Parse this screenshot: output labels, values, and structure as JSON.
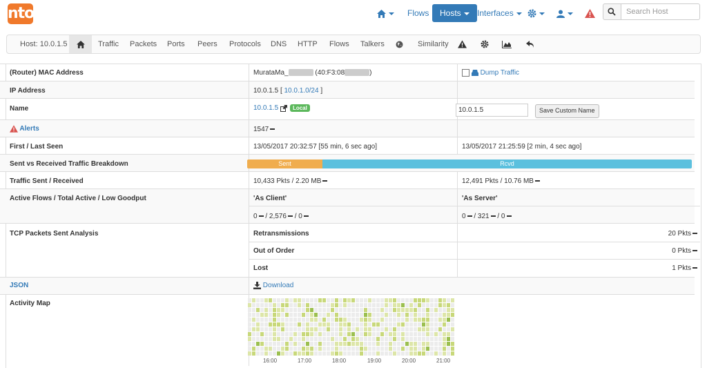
{
  "app": {
    "logo": "ntop"
  },
  "nav": {
    "flows": "Flows",
    "hosts": "Hosts",
    "interfaces": "Interfaces",
    "search_placeholder": "Search Host"
  },
  "subnav": {
    "host": "Host: 10.0.1.5",
    "items": [
      "Traffic",
      "Packets",
      "Ports",
      "Peers",
      "Protocols",
      "DNS",
      "HTTP",
      "Flows",
      "Talkers",
      "Similarity"
    ]
  },
  "rows": {
    "mac": {
      "label": "(Router) MAC Address",
      "value_prefix": "MurataMa_",
      "value_mid": "(40:F3:08",
      "value_suffix": ")",
      "dump": "Dump Traffic"
    },
    "ip": {
      "label": "IP Address",
      "value": "10.0.1.5",
      "open": "[",
      "network": "10.0.1.0/24",
      "close": "]"
    },
    "name": {
      "label": "Name",
      "value": "10.0.1.5",
      "badge": "Local",
      "input_value": "10.0.1.5",
      "button": "Save Custom Name"
    },
    "alerts": {
      "label": "Alerts",
      "value": "1547"
    },
    "seen": {
      "label": "First / Last Seen",
      "first": "13/05/2017 20:32:57 [55 min, 6 sec ago]",
      "last": "13/05/2017 21:25:59 [2 min, 4 sec ago]"
    },
    "breakdown": {
      "label": "Sent vs Received Traffic Breakdown",
      "sent_label": "Sent",
      "rcvd_label": "Rcvd",
      "sent_fraction": 0.17
    },
    "traffic": {
      "label": "Traffic Sent / Received",
      "sent": "10,433 Pkts / 2.20 MB",
      "rcvd": "12,491 Pkts / 10.76 MB"
    },
    "flows": {
      "label": "Active Flows / Total Active / Low Goodput",
      "client_hdr": "'As Client'",
      "server_hdr": "'As Server'",
      "client_a": "0",
      "client_b": "/ 2,576",
      "client_c": "/ 0",
      "server_a": "0",
      "server_b": "/ 321",
      "server_c": "/ 0"
    },
    "tcp": {
      "label": "TCP Packets Sent Analysis",
      "retrans_label": "Retransmissions",
      "retrans": "20 Pkts",
      "ooo_label": "Out of Order",
      "ooo": "0 Pkts",
      "lost_label": "Lost",
      "lost": "1 Pkts"
    },
    "json": {
      "label": "JSON",
      "download": "Download"
    },
    "activity": {
      "label": "Activity Map",
      "ticks": [
        "16:00",
        "17:00",
        "18:00",
        "19:00",
        "20:00",
        "21:00"
      ]
    }
  },
  "colors": {
    "accent": "#337ab7",
    "sent": "#f0ad4e",
    "rcvd": "#5bc0de",
    "local": "#5cb85c",
    "alert": "#d9534f",
    "logo": "#f0792b"
  }
}
